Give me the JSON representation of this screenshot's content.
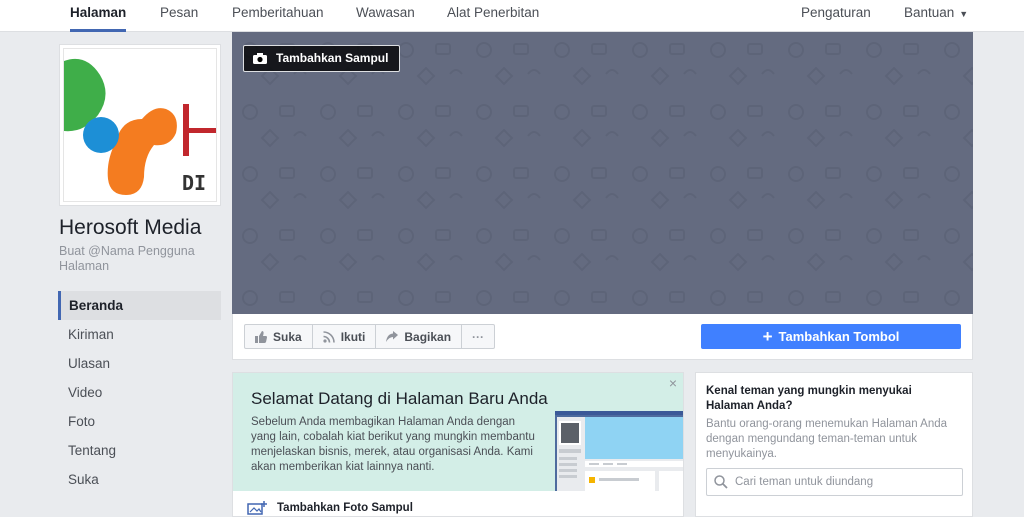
{
  "topnav": {
    "tabs": [
      {
        "label": "Halaman"
      },
      {
        "label": "Pesan"
      },
      {
        "label": "Pemberitahuan"
      },
      {
        "label": "Wawasan"
      },
      {
        "label": "Alat Penerbitan"
      }
    ],
    "settings": "Pengaturan",
    "help": "Bantuan"
  },
  "page": {
    "name": "Herosoft Media",
    "username_prompt": "Buat @Nama Pengguna Halaman",
    "logo_text": "DI"
  },
  "sidebar": {
    "items": [
      {
        "label": "Beranda"
      },
      {
        "label": "Kiriman"
      },
      {
        "label": "Ulasan"
      },
      {
        "label": "Video"
      },
      {
        "label": "Foto"
      },
      {
        "label": "Tentang"
      },
      {
        "label": "Suka"
      }
    ]
  },
  "cover": {
    "add_cover_label": "Tambahkan Sampul"
  },
  "actions": {
    "like": "Suka",
    "follow": "Ikuti",
    "share": "Bagikan",
    "more": "···",
    "add_button": "Tambahkan Tombol"
  },
  "welcome": {
    "title": "Selamat Datang di Halaman Baru Anda",
    "body": "Sebelum Anda membagikan Halaman Anda dengan yang lain, cobalah kiat berikut yang mungkin membantu menjelaskan bisnis, merek, atau organisasi Anda. Kami akan memberikan kiat lainnya nanti.",
    "close": "×",
    "step1": "Tambahkan Foto Sampul"
  },
  "invite": {
    "title": "Kenal teman yang mungkin menyukai Halaman Anda?",
    "body": "Bantu orang-orang menemukan Halaman Anda dengan mengundang teman-teman untuk menyukainya.",
    "search_placeholder": "Cari teman untuk diundang"
  },
  "colors": {
    "accent": "#4267b2",
    "primary_button": "#4080ff",
    "cover": "#646b80",
    "welcome_banner": "#d3eee7"
  }
}
